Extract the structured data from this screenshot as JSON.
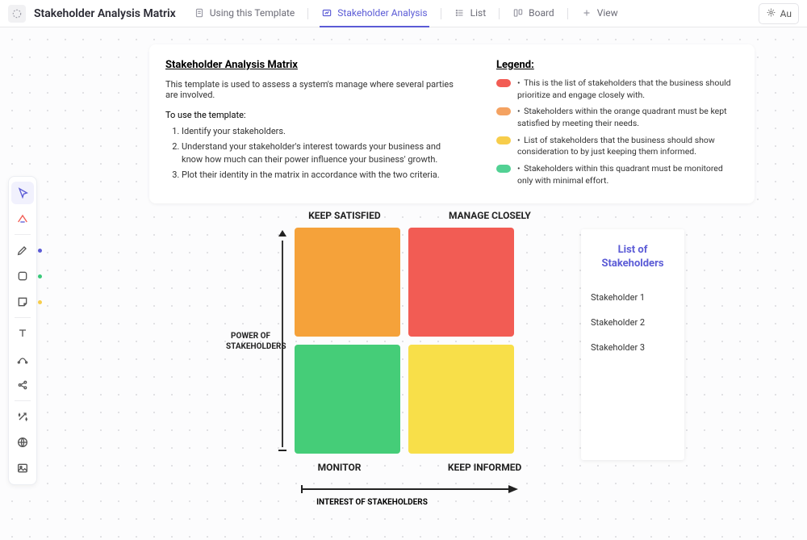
{
  "header": {
    "title": "Stakeholder Analysis Matrix",
    "tabs": [
      {
        "label": "Using this Template"
      },
      {
        "label": "Stakeholder Analysis"
      },
      {
        "label": "List"
      },
      {
        "label": "Board"
      },
      {
        "label": "View"
      }
    ],
    "right_button": "Au"
  },
  "sidebar": {
    "colors": {
      "pen": "#5b5bd6",
      "shape": "#3ac97a",
      "sticky": "#f7cd4b"
    }
  },
  "info": {
    "title": "Stakeholder Analysis Matrix",
    "description": "This template is used to assess a system's manage where several parties are involved.",
    "to_use": "To use the template:",
    "steps": [
      "Identify your stakeholders.",
      "Understand your stakeholder's interest towards your business and know how much can their power influence your business' growth.",
      "Plot their identity in the matrix in accordance with the two criteria."
    ],
    "legend_title": "Legend:",
    "legend": [
      {
        "color": "#f25c54",
        "text": "This is the list of stakeholders that the business should prioritize and engage closely with."
      },
      {
        "color": "#f4a261",
        "text": "Stakeholders within the orange quadrant must be kept satisfied by meeting their needs."
      },
      {
        "color": "#f7cd4b",
        "text": "List of stakeholders that the business should show consideration to by just keeping them informed."
      },
      {
        "color": "#52d194",
        "text": "Stakeholders within this quadrant must be monitored only with minimal effort."
      }
    ]
  },
  "matrix": {
    "top_labels": [
      "KEEP SATISFIED",
      "MANAGE CLOSELY"
    ],
    "bottom_labels": [
      "MONITOR",
      "KEEP INFORMED"
    ],
    "y_axis": "POWER OF STAKEHOLDERS",
    "x_axis": "INTEREST OF STAKEHOLDERS",
    "quad_colors": {
      "tl": "#f5a23a",
      "tr": "#f25c54",
      "bl": "#45cd78",
      "br": "#f8df49"
    }
  },
  "stakeholders": {
    "title": "List of Stakeholders",
    "items": [
      "Stakeholder 1",
      "Stakeholder 2",
      "Stakeholder 3"
    ]
  }
}
